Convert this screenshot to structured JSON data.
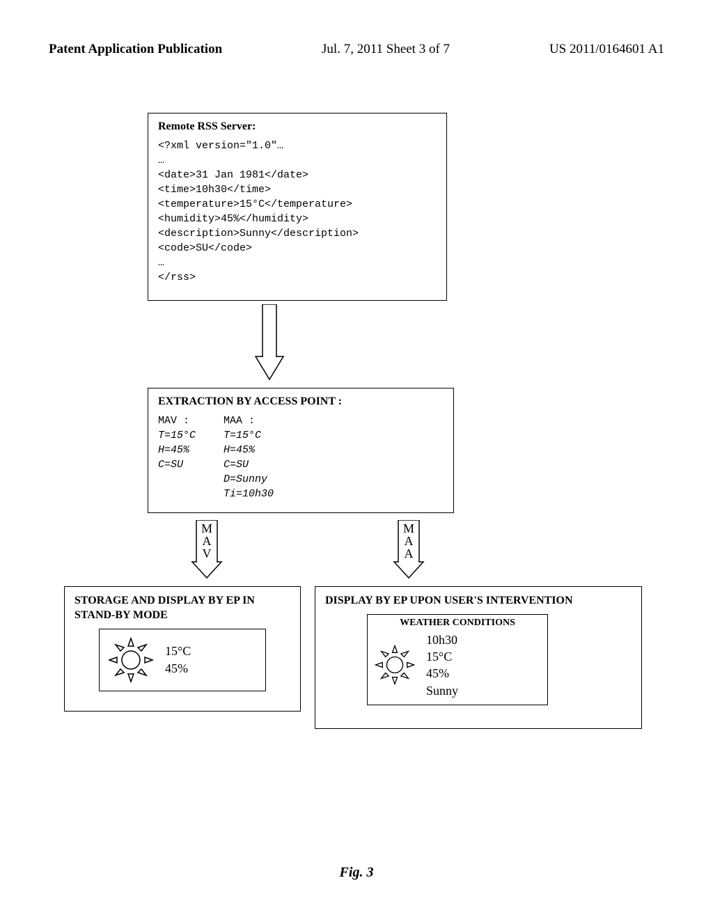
{
  "header": {
    "left": "Patent Application Publication",
    "center": "Jul. 7, 2011   Sheet 3 of 7",
    "right": "US 2011/0164601 A1"
  },
  "rss": {
    "title": "Remote RSS Server:",
    "line1": "<?xml version=\"1.0\"…",
    "line2": "…",
    "line3": "<date>31 Jan 1981</date>",
    "line4": "<time>10h30</time>",
    "line5": "<temperature>15°C</temperature>",
    "line6": "<humidity>45%</humidity>",
    "line7": "<description>Sunny</description>",
    "line8": "<code>SU</code>",
    "line9": "…",
    "line10": "</rss>"
  },
  "extraction": {
    "title": "EXTRACTION BY ACCESS POINT :",
    "mav": {
      "label": "MAV :",
      "t": "T=15°C",
      "h": "H=45%",
      "c": "C=SU"
    },
    "maa": {
      "label": "MAA :",
      "t": "T=15°C",
      "h": "H=45%",
      "c": "C=SU",
      "d": "D=Sunny",
      "ti": "Ti=10h30"
    }
  },
  "arrows": {
    "mav_label": "M\nA\nV",
    "maa_label": "M\nA\nA"
  },
  "standby": {
    "title": "STORAGE AND DISPLAY BY EP IN STAND-BY MODE",
    "temp": "15°C",
    "hum": "45%"
  },
  "userbox": {
    "title": "DISPLAY BY EP UPON USER'S INTERVENTION",
    "weather_title": "WEATHER CONDITIONS",
    "time": "10h30",
    "temp": "15°C",
    "hum": "45%",
    "desc": "Sunny"
  },
  "figure_caption": "Fig. 3"
}
